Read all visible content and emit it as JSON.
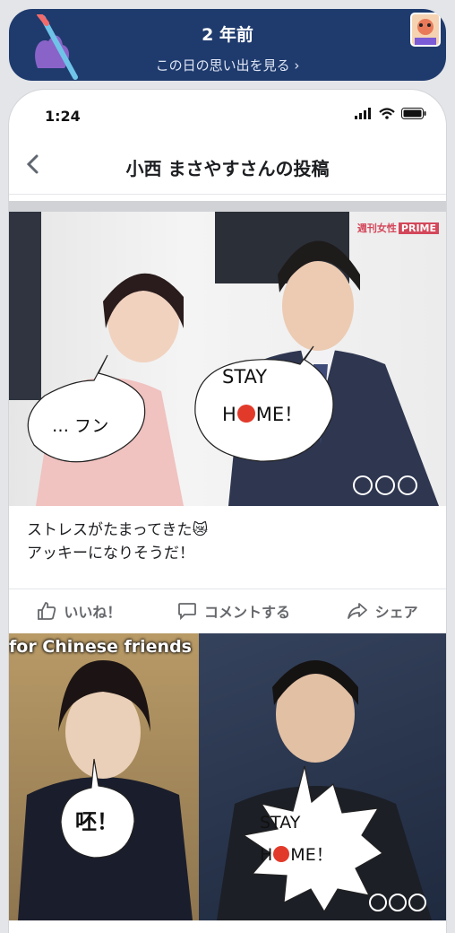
{
  "banner": {
    "years": "2 年前",
    "link": "この日の思い出を見る ›"
  },
  "status": {
    "time": "1:24"
  },
  "nav": {
    "title": "小西 まさやすさんの投稿"
  },
  "post1": {
    "watermark_a": "週刊女性",
    "watermark_b": "PRIME",
    "bubble_left": "… フン",
    "bubble_right_l1": "STAY",
    "bubble_right_l2a": "H",
    "bubble_right_l2b": "ME！",
    "caption_l1": "ストレスがたまってきた😿",
    "caption_l2": "アッキーになりそうだ！"
  },
  "actions": {
    "like": "いいね！",
    "comment": "コメントする",
    "share": "シェア"
  },
  "post2": {
    "caption": "for Chinese friends",
    "bubble_left": "呸！",
    "bubble_right_l1": "STAY",
    "bubble_right_l2a": "H",
    "bubble_right_l2b": "ME！"
  },
  "icons": [
    "pen-icon",
    "sticker-icon",
    "back-chevron-icon",
    "signal-icon",
    "wifi-icon",
    "battery-icon",
    "like-icon",
    "comment-icon",
    "share-icon",
    "emoji-angry-icon"
  ],
  "colors": {
    "banner": "#1f3b6e",
    "brand_red": "#d3475a",
    "action_gray": "#65676b"
  }
}
